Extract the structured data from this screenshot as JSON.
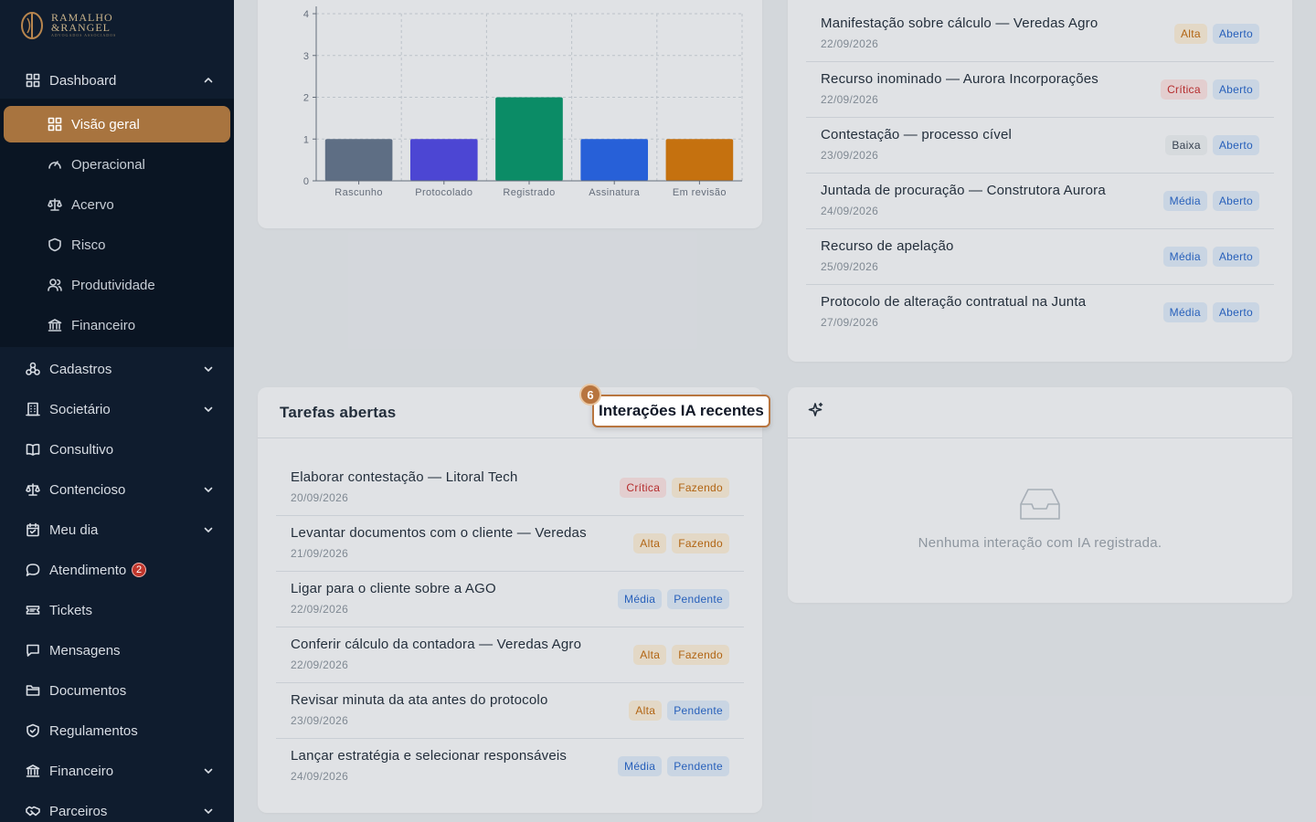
{
  "brand": {
    "line1": "RAMALHO",
    "line2": "&RANGEL",
    "tagline": "ADVOGADOS ASSOCIADOS"
  },
  "sidebar": {
    "dashboard": {
      "label": "Dashboard",
      "icon": "grid-icon"
    },
    "sub": [
      {
        "label": "Visão geral",
        "icon": "grid-icon",
        "active": true
      },
      {
        "label": "Operacional",
        "icon": "gauge-icon"
      },
      {
        "label": "Acervo",
        "icon": "scale-icon"
      },
      {
        "label": "Risco",
        "icon": "shield-icon"
      },
      {
        "label": "Produtividade",
        "icon": "users-icon"
      },
      {
        "label": "Financeiro",
        "icon": "bank-icon"
      }
    ],
    "items": [
      {
        "label": "Cadastros",
        "icon": "network-icon",
        "chevron": true
      },
      {
        "label": "Societário",
        "icon": "building-icon",
        "chevron": true
      },
      {
        "label": "Consultivo",
        "icon": "book-icon",
        "chevron": false
      },
      {
        "label": "Contencioso",
        "icon": "scale-icon",
        "chevron": true
      },
      {
        "label": "Meu dia",
        "icon": "calendar-icon",
        "chevron": true
      },
      {
        "label": "Atendimento",
        "icon": "chat-icon",
        "chevron": false,
        "badge": "2"
      },
      {
        "label": "Tickets",
        "icon": "ticket-icon",
        "chevron": false
      },
      {
        "label": "Mensagens",
        "icon": "message-icon",
        "chevron": false
      },
      {
        "label": "Documentos",
        "icon": "folder-icon",
        "chevron": false
      },
      {
        "label": "Regulamentos",
        "icon": "shield-check-icon",
        "chevron": false
      },
      {
        "label": "Financeiro",
        "icon": "bank-icon",
        "chevron": true
      },
      {
        "label": "Parceiros",
        "icon": "handshake-icon",
        "chevron": true
      }
    ]
  },
  "chart_data": {
    "type": "bar",
    "categories": [
      "Rascunho",
      "Protocolado",
      "Registrado",
      "Assinatura",
      "Em revisão"
    ],
    "values": [
      1,
      1,
      2,
      1,
      1
    ],
    "colors": [
      "#64748b",
      "#4f46e5",
      "#059669",
      "#2563eb",
      "#d97706"
    ],
    "y_ticks": [
      "0",
      "1",
      "2",
      "3",
      "4"
    ],
    "ylim": [
      0,
      4
    ],
    "grid": true
  },
  "prazos": {
    "rows": [
      {
        "title": "Manifestação sobre cálculo — Veredas Agro",
        "date": "22/09/2026",
        "priority": "Alta",
        "status": "Aberto"
      },
      {
        "title": "Recurso inominado — Aurora Incorporações",
        "date": "22/09/2026",
        "priority": "Crítica",
        "status": "Aberto"
      },
      {
        "title": "Contestação — processo cível",
        "date": "23/09/2026",
        "priority": "Baixa",
        "status": "Aberto"
      },
      {
        "title": "Juntada de procuração — Construtora Aurora",
        "date": "24/09/2026",
        "priority": "Média",
        "status": "Aberto"
      },
      {
        "title": "Recurso de apelação",
        "date": "25/09/2026",
        "priority": "Média",
        "status": "Aberto"
      },
      {
        "title": "Protocolo de alteração contratual na Junta",
        "date": "27/09/2026",
        "priority": "Média",
        "status": "Aberto"
      }
    ]
  },
  "tarefas": {
    "title": "Tarefas abertas",
    "rows": [
      {
        "title": "Elaborar contestação — Litoral Tech",
        "date": "20/09/2026",
        "priority": "Crítica",
        "status": "Fazendo"
      },
      {
        "title": "Levantar documentos com o cliente — Veredas",
        "date": "21/09/2026",
        "priority": "Alta",
        "status": "Fazendo"
      },
      {
        "title": "Ligar para o cliente sobre a AGO",
        "date": "22/09/2026",
        "priority": "Média",
        "status": "Pendente"
      },
      {
        "title": "Conferir cálculo da contadora — Veredas Agro",
        "date": "22/09/2026",
        "priority": "Alta",
        "status": "Fazendo"
      },
      {
        "title": "Revisar minuta da ata antes do protocolo",
        "date": "23/09/2026",
        "priority": "Alta",
        "status": "Pendente"
      },
      {
        "title": "Lançar estratégia e selecionar responsáveis",
        "date": "24/09/2026",
        "priority": "Média",
        "status": "Pendente"
      }
    ]
  },
  "ia": {
    "title": "Interações IA recentes",
    "step": "6",
    "empty": "Nenhuma interação com IA registrada."
  },
  "tag_colors": {
    "Alta": {
      "bg": "#fbecd6",
      "fg": "#c2680a"
    },
    "Crítica": {
      "bg": "#fbe1e1",
      "fg": "#c62828"
    },
    "Baixa": {
      "bg": "#eceef1",
      "fg": "#374151"
    },
    "Média": {
      "bg": "#dde9f8",
      "fg": "#2563c9"
    },
    "Aberto": {
      "bg": "#dde9f8",
      "fg": "#2563c9"
    },
    "Fazendo": {
      "bg": "#fbecd6",
      "fg": "#c2680a"
    },
    "Pendente": {
      "bg": "#dde9f8",
      "fg": "#2563c9"
    }
  }
}
